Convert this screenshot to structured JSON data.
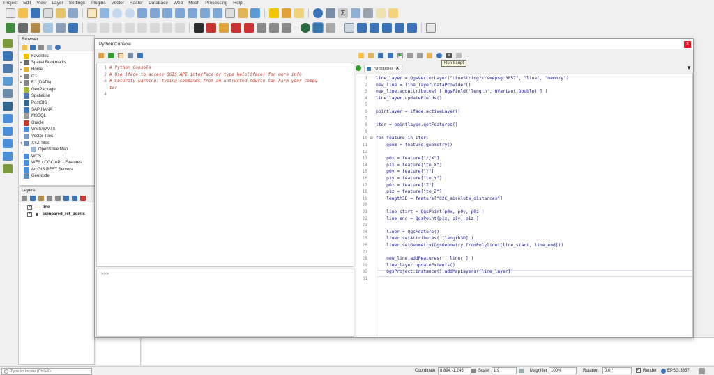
{
  "menu": [
    "Project",
    "Edit",
    "View",
    "Layer",
    "Settings",
    "Plugins",
    "Vector",
    "Raster",
    "Database",
    "Web",
    "Mesh",
    "Processing",
    "Help"
  ],
  "browser": {
    "title": "Browser",
    "items": [
      {
        "label": "Favorites",
        "icon": "star-icon",
        "color": "#f2c500",
        "arrow": ""
      },
      {
        "label": "Spatial Bookmarks",
        "icon": "bookmark-icon",
        "color": "#6a6a6a",
        "arrow": "▸"
      },
      {
        "label": "Home",
        "icon": "home-folder-icon",
        "color": "#e2b23c",
        "arrow": "▸"
      },
      {
        "label": "C:\\",
        "icon": "drive-icon",
        "color": "#888888",
        "arrow": "▸"
      },
      {
        "label": "E:\\ (DATA)",
        "icon": "drive-icon",
        "color": "#888888",
        "arrow": "▸"
      },
      {
        "label": "GeoPackage",
        "icon": "geopackage-icon",
        "color": "#a5b63a",
        "arrow": ""
      },
      {
        "label": "SpatiaLite",
        "icon": "spatialite-icon",
        "color": "#4a7ab0",
        "arrow": ""
      },
      {
        "label": "PostGIS",
        "icon": "postgis-icon",
        "color": "#336791",
        "arrow": ""
      },
      {
        "label": "SAP HANA",
        "icon": "saphana-icon",
        "color": "#3d7bbf",
        "arrow": ""
      },
      {
        "label": "MSSQL",
        "icon": "mssql-icon",
        "color": "#9a9a9a",
        "arrow": ""
      },
      {
        "label": "Oracle",
        "icon": "oracle-icon",
        "color": "#c0392b",
        "arrow": ""
      },
      {
        "label": "WMS/WMTS",
        "icon": "wms-icon",
        "color": "#4a90d9",
        "arrow": ""
      },
      {
        "label": "Vector Tiles",
        "icon": "vector-tiles-icon",
        "color": "#7a9bc4",
        "arrow": ""
      },
      {
        "label": "XYZ Tiles",
        "icon": "xyz-tiles-icon",
        "color": "#6c8cb8",
        "arrow": "▾"
      },
      {
        "label": "OpenStreetMap",
        "icon": "osm-icon",
        "color": "#9fb8d8",
        "arrow": "",
        "indent": true
      },
      {
        "label": "WCS",
        "icon": "wcs-icon",
        "color": "#4a90d9",
        "arrow": ""
      },
      {
        "label": "WFS / OGC API - Features",
        "icon": "wfs-icon",
        "color": "#4a90d9",
        "arrow": ""
      },
      {
        "label": "ArcGIS REST Servers",
        "icon": "arcgis-icon",
        "color": "#4a90d9",
        "arrow": ""
      },
      {
        "label": "GeoNode",
        "icon": "geonode-icon",
        "color": "#5a8fbf",
        "arrow": ""
      }
    ]
  },
  "layers": {
    "title": "Layers",
    "items": [
      {
        "label": "line",
        "checked": "✓",
        "symbol": "line-symbol-icon",
        "color": "#b7a06a"
      },
      {
        "label": "compared_ref_points",
        "checked": "✓",
        "symbol": "point-symbol-icon",
        "color": "#444444"
      }
    ]
  },
  "console": {
    "title": "Python Console",
    "close": "×",
    "output_lines": [
      {
        "n": "1",
        "text": "# Python Console"
      },
      {
        "n": "2",
        "text": "# Use iface to access QGIS API interface or type help(iface) for more info"
      },
      {
        "n": "3",
        "text": "# Security warning: typing commands from an untrusted source can harm your compu"
      },
      {
        "n": "",
        "text": "ter"
      },
      {
        "n": "4",
        "text": ""
      }
    ],
    "prompt": ">>>",
    "tooltip": "Run Script",
    "tab_label": "*Untitled-0",
    "tab_close": "✕",
    "code_lines": [
      {
        "n": "1",
        "fold": "",
        "text": "line_layer = QgsVectorLayer(\"LineString?crs=epsg:3857\", \"line\", \"memory\")"
      },
      {
        "n": "2",
        "fold": "",
        "text": "new_line = line_layer.dataProvider()"
      },
      {
        "n": "3",
        "fold": "",
        "text": "new_line.addAttributes( [ QgsField('length', QVariant.Double) ] )"
      },
      {
        "n": "4",
        "fold": "",
        "text": "line_layer.updateFields()"
      },
      {
        "n": "5",
        "fold": "",
        "text": ""
      },
      {
        "n": "6",
        "fold": "",
        "text": "pointlayer = iface.activeLayer()"
      },
      {
        "n": "7",
        "fold": "",
        "text": ""
      },
      {
        "n": "8",
        "fold": "",
        "text": "iter = pointlayer.getFeatures()"
      },
      {
        "n": "9",
        "fold": "",
        "text": ""
      },
      {
        "n": "10",
        "fold": "⊟",
        "text": "for feature in iter:"
      },
      {
        "n": "11",
        "fold": "",
        "text": "    geom = feature.geometry()"
      },
      {
        "n": "12",
        "fold": "",
        "text": ""
      },
      {
        "n": "13",
        "fold": "",
        "text": "    p0x = feature[\"//X\"]"
      },
      {
        "n": "14",
        "fold": "",
        "text": "    p1x = feature[\"to_X\"]"
      },
      {
        "n": "15",
        "fold": "",
        "text": "    p0y = feature[\"Y\"]"
      },
      {
        "n": "16",
        "fold": "",
        "text": "    p1y = feature[\"to_Y\"]"
      },
      {
        "n": "17",
        "fold": "",
        "text": "    p0z = feature[\"Z\"]"
      },
      {
        "n": "18",
        "fold": "",
        "text": "    p1z = feature[\"to_Z\"]"
      },
      {
        "n": "19",
        "fold": "",
        "text": "    length3D = feature[\"C2C_absolute_distances\"]"
      },
      {
        "n": "20",
        "fold": "",
        "text": ""
      },
      {
        "n": "21",
        "fold": "",
        "text": "    line_start = QgsPoint(p0x, p0y, p0z )"
      },
      {
        "n": "22",
        "fold": "",
        "text": "    line_end = QgsPoint(p1x, p1y, p1z )"
      },
      {
        "n": "23",
        "fold": "",
        "text": ""
      },
      {
        "n": "24",
        "fold": "",
        "text": "    liner = QgsFeature()"
      },
      {
        "n": "25",
        "fold": "",
        "text": "    liner.setAttributes( [length3D] )"
      },
      {
        "n": "26",
        "fold": "",
        "text": "    liner.setGeometry(QgsGeometry.fromPolyline([line_start, line_end]))"
      },
      {
        "n": "27",
        "fold": "",
        "text": ""
      },
      {
        "n": "28",
        "fold": "",
        "text": "    new_line.addFeatures( [ liner ] )"
      },
      {
        "n": "29",
        "fold": "",
        "text": "    line_layer.updateExtents()"
      },
      {
        "n": "30",
        "fold": "",
        "text": "    QgsProject.instance().addMapLayers([line_layer])"
      },
      {
        "n": "31",
        "fold": "",
        "text": ""
      }
    ]
  },
  "status": {
    "locator_placeholder": "Type to locate (Ctrl+K)",
    "coordinate_label": "Coordinate",
    "coordinate_value": "8,894,-1,245",
    "scale_label": "Scale",
    "scale_value": "1:9",
    "magnifier_label": "Magnifier",
    "magnifier_value": "100%",
    "rotation_label": "Rotation",
    "rotation_value": "0,0 °",
    "render_label": "Render",
    "render_checked": "✓",
    "crs_label": "EPSG:3857"
  },
  "colors": {
    "comment": "#c0392b",
    "code": "#1a1a8a",
    "run_green": "#2e9e2e",
    "close_red": "#e81123"
  }
}
